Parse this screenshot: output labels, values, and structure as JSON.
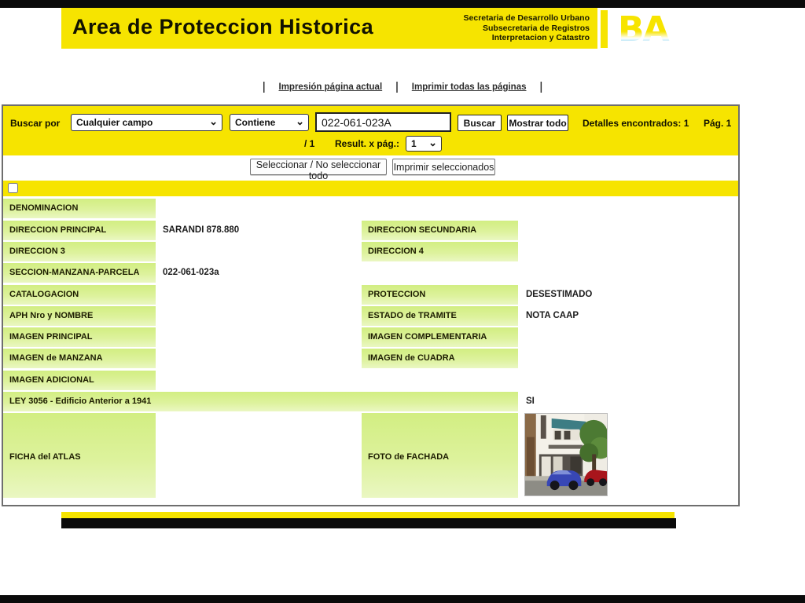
{
  "header": {
    "title": "Area de Proteccion Historica",
    "org_lines": {
      "l1": "Secretaria de Desarrollo Urbano",
      "l2": "Subsecretaria de Registros",
      "l3": "Interpretacion y Catastro"
    },
    "logo_text": "BA"
  },
  "print_links": {
    "separator": "|",
    "current_page": "Impresión página actual",
    "all_pages": "Imprimir todas las páginas"
  },
  "search": {
    "label": "Buscar por",
    "field_select": "Cualquier campo",
    "operator_select": "Contiene",
    "query_value": "022-061-023A",
    "search_button": "Buscar",
    "show_all_button": "Mostrar todo",
    "results_found": "Detalles encontrados: 1",
    "page_indicator": "Pág. 1",
    "page_fraction": "/ 1",
    "per_page_label": "Result. x pág.:",
    "per_page_value": "1"
  },
  "actions": {
    "select_all_button": "Seleccionar / No seleccionar todo",
    "print_selected_button": "Imprimir seleccionados"
  },
  "record": {
    "left_fields": [
      {
        "label": "DENOMINACION",
        "value": ""
      },
      {
        "label": "DIRECCION PRINCIPAL",
        "value": "SARANDI 878.880"
      },
      {
        "label": "DIRECCION 3",
        "value": ""
      },
      {
        "label": "SECCION-MANZANA-PARCELA",
        "value": "022-061-023a"
      },
      {
        "label": "CATALOGACION",
        "value": ""
      },
      {
        "label": "APH Nro y NOMBRE",
        "value": ""
      },
      {
        "label": "IMAGEN PRINCIPAL",
        "value": ""
      },
      {
        "label": "IMAGEN de MANZANA",
        "value": ""
      },
      {
        "label": "IMAGEN ADICIONAL",
        "value": ""
      }
    ],
    "right_fields": [
      {
        "label": "DIRECCION SECUNDARIA",
        "value": ""
      },
      {
        "label": "DIRECCION 4",
        "value": ""
      },
      {
        "label": "PROTECCION",
        "value": "DESESTIMADO"
      },
      {
        "label": "ESTADO de TRAMITE",
        "value": "NOTA CAAP"
      },
      {
        "label": "IMAGEN COMPLEMENTARIA",
        "value": ""
      },
      {
        "label": "IMAGEN de CUADRA",
        "value": ""
      }
    ],
    "ley_row": {
      "label": "LEY 3056 - Edificio Anterior a 1941",
      "value": "SI"
    },
    "ficha_label": "FICHA del ATLAS",
    "foto_label": "FOTO de FACHADA"
  }
}
